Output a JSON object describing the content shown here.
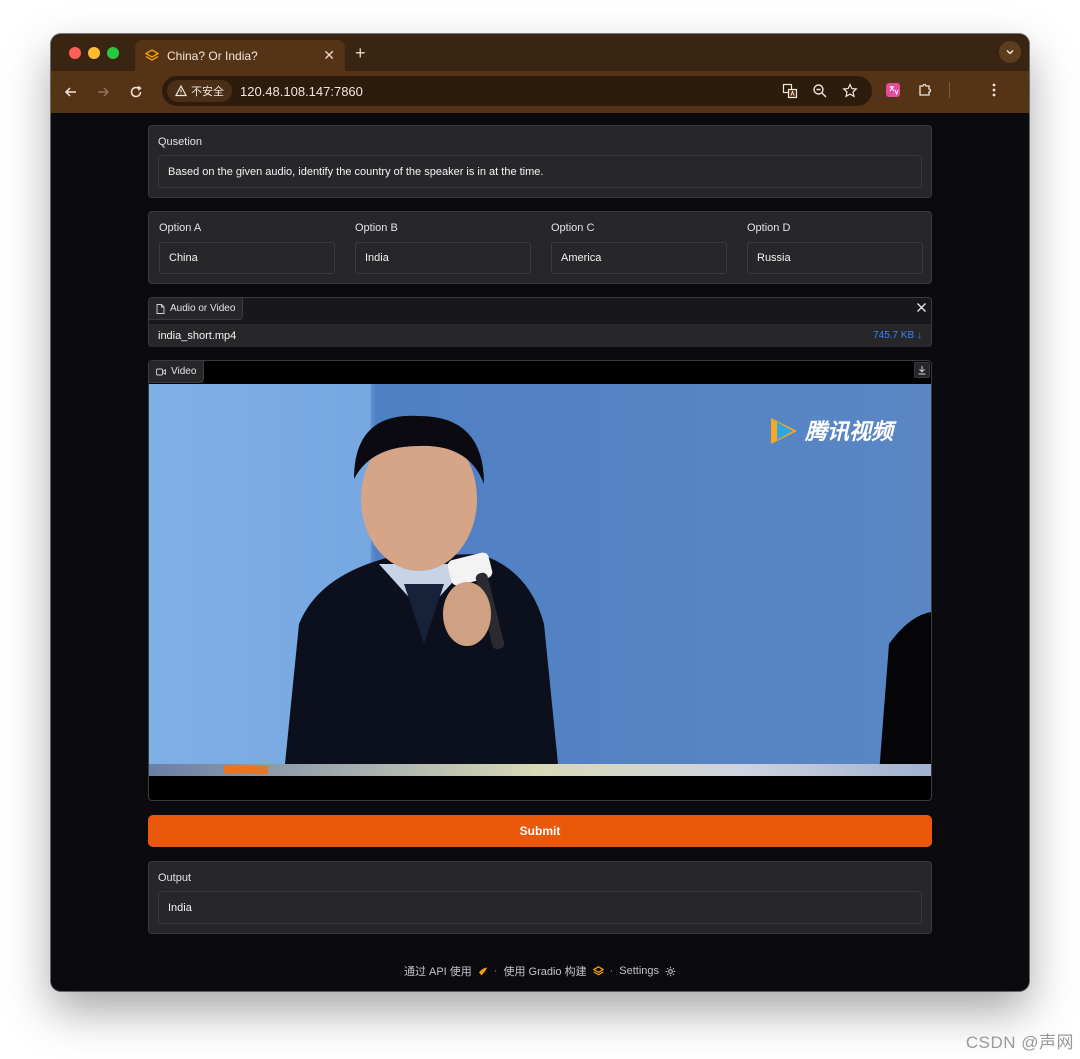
{
  "browser": {
    "tab_title": "China? Or India?",
    "security_label": "不安全",
    "url": "120.48.108.147:7860"
  },
  "question": {
    "label": "Qusetion",
    "value": "Based on the given audio, identify the country of the speaker is in at the time."
  },
  "options": [
    {
      "label": "Option A",
      "value": "China"
    },
    {
      "label": "Option B",
      "value": "India"
    },
    {
      "label": "Option C",
      "value": "America"
    },
    {
      "label": "Option D",
      "value": "Russia"
    }
  ],
  "file_upload": {
    "label": "Audio or Video",
    "filename": "india_short.mp4",
    "size": "745.7 KB ↓"
  },
  "video": {
    "label": "Video",
    "watermark_text": "腾讯视频"
  },
  "submit_label": "Submit",
  "output": {
    "label": "Output",
    "value": "India"
  },
  "footer": {
    "api": "通过 API 使用",
    "gradio": "使用 Gradio 构建",
    "settings": "Settings"
  },
  "page_watermark": "CSDN @声网",
  "colors": {
    "accent": "#ea580c",
    "file_size": "#3b82f6",
    "panel": "#27272a",
    "page_bg": "#0b0b0f"
  }
}
